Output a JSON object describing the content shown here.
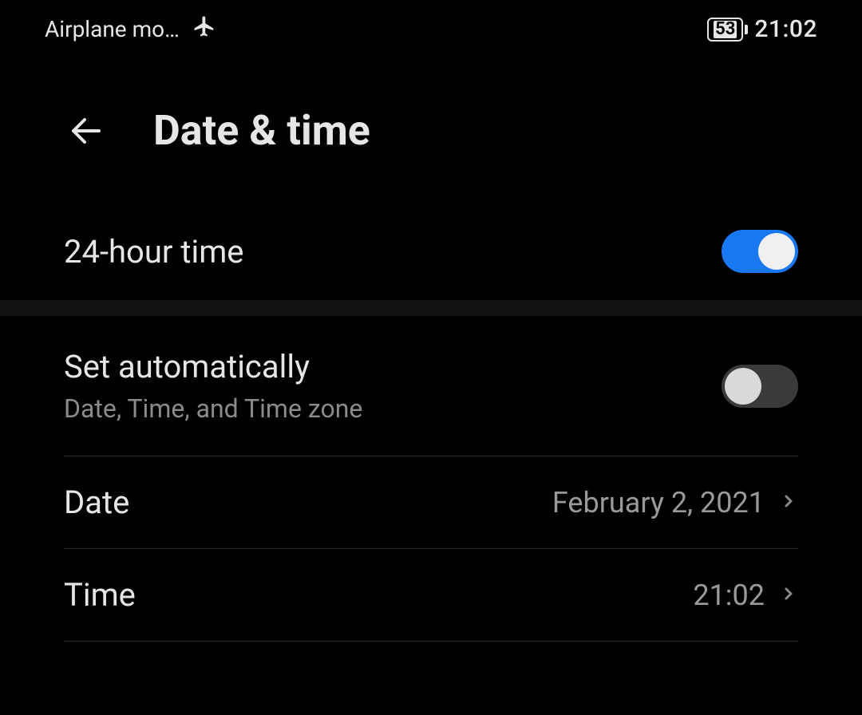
{
  "statusbar": {
    "airplane_text": "Airplane mo…",
    "battery_pct": "53",
    "clock": "21:02"
  },
  "header": {
    "title": "Date & time"
  },
  "settings": {
    "hour24": {
      "label": "24-hour time",
      "enabled": true
    },
    "auto": {
      "label": "Set automatically",
      "sublabel": "Date, Time, and Time zone",
      "enabled": false
    },
    "date": {
      "label": "Date",
      "value": "February 2, 2021"
    },
    "time": {
      "label": "Time",
      "value": "21:02"
    }
  }
}
